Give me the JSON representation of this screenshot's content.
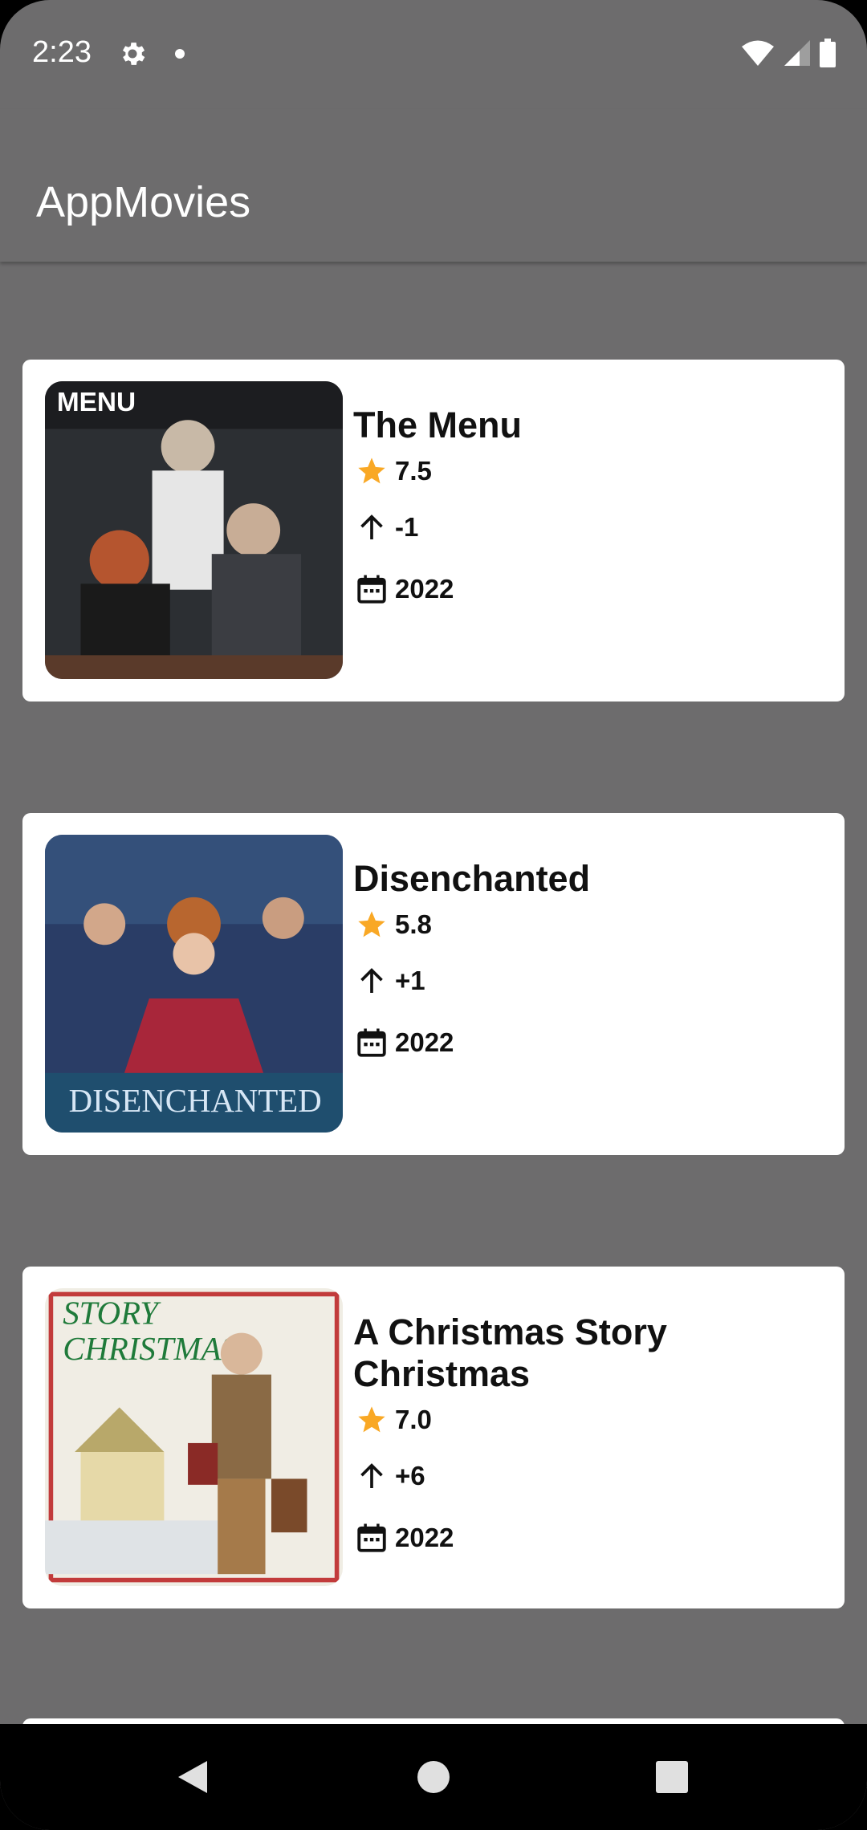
{
  "status": {
    "time": "2:23"
  },
  "app": {
    "title": "AppMovies"
  },
  "movies": [
    {
      "title": "The Menu",
      "rating": "7.5",
      "trend": "-1",
      "year": "2022",
      "poster_colors": [
        "#2c2f33",
        "#8a8c90",
        "#5a3a2a"
      ]
    },
    {
      "title": "Disenchanted",
      "rating": "5.8",
      "trend": "+1",
      "year": "2022",
      "poster_colors": [
        "#3a4a78",
        "#a8263a",
        "#2a6a8a"
      ]
    },
    {
      "title": "A Christmas Story Christmas",
      "rating": "7.0",
      "trend": "+6",
      "year": "2022",
      "poster_colors": [
        "#f0ede4",
        "#1f7a3a",
        "#a57a4a"
      ]
    }
  ],
  "colors": {
    "star": "#f9a825",
    "background": "#6d6c6d",
    "card": "#ffffff"
  },
  "icons": {
    "rating": "star-icon",
    "trend": "arrow-up-icon",
    "year": "calendar-icon"
  }
}
